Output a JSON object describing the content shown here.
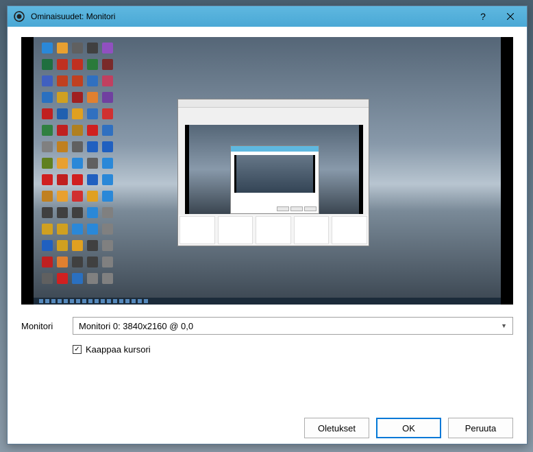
{
  "titlebar": {
    "title": "Ominaisuudet: Monitori"
  },
  "form": {
    "monitor_label": "Monitori",
    "monitor_value": "Monitori 0: 3840x2160 @ 0,0",
    "capture_cursor_label": "Kaappaa kursori"
  },
  "buttons": {
    "defaults": "Oletukset",
    "ok": "OK",
    "cancel": "Peruuta"
  },
  "icons": [
    "#2a88d8",
    "#e8a030",
    "#606060",
    "#404040",
    "#9050c0",
    "#1f6f3f",
    "#c03020",
    "#c03020",
    "#2a7a3a",
    "#7a2a2a",
    "#4060c0",
    "#c04020",
    "#c04020",
    "#3070c0",
    "#c04060",
    "#2a70c0",
    "#d0a020",
    "#a02020",
    "#e08030",
    "#7040a0",
    "#c02020",
    "#2060b0",
    "#e0a020",
    "#3070c0",
    "#d03030",
    "#308040",
    "#c02020",
    "#b08020",
    "#d02020",
    "#3070c0",
    "#808080",
    "#c08020",
    "#606060",
    "#2060c0",
    "#2060c0",
    "#608020",
    "#e8a030",
    "#2a88d8",
    "#606060",
    "#2a88d8",
    "#d02020",
    "#c02020",
    "#d02020",
    "#2060c0",
    "#2a88d8",
    "#c08020",
    "#e8a030",
    "#d03030",
    "#e0a020",
    "#2a88d8",
    "#404040",
    "#404040",
    "#404040",
    "#2a88d8",
    "#808080",
    "#d0a020",
    "#d0a020",
    "#2a88d8",
    "#2a88d8",
    "#808080",
    "#2060c0",
    "#d0a020",
    "#e0a020",
    "#404040",
    "#808080",
    "#c02020",
    "#e08030",
    "#404040",
    "#404040",
    "#808080",
    "#606060",
    "#d02020",
    "#2a70c0",
    "#808080",
    "#808080"
  ]
}
